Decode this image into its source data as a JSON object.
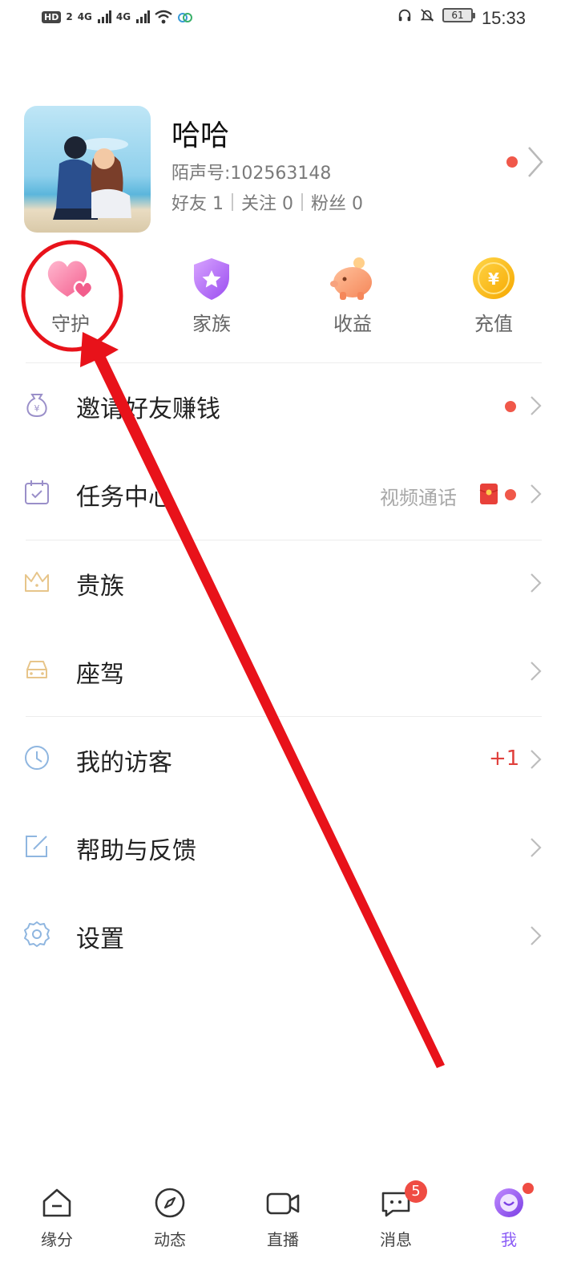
{
  "status_bar": {
    "hd": "HD",
    "hd_sim": "2",
    "signal_1": "4G",
    "signal_2": "4G",
    "battery": "61",
    "time": "15:33"
  },
  "profile": {
    "name": "哈哈",
    "id_text": "陌声号:102563148",
    "friends": "好友 1",
    "following": "关注 0",
    "fans": "粉丝 0"
  },
  "quick_actions": [
    {
      "label": "守护",
      "icon": "heart-icon"
    },
    {
      "label": "家族",
      "icon": "shield-star-icon"
    },
    {
      "label": "收益",
      "icon": "piggy-bank-icon"
    },
    {
      "label": "充值",
      "icon": "yuan-coin-icon"
    }
  ],
  "menu": [
    {
      "label": "邀请好友赚钱",
      "icon": "money-bag-icon",
      "dot": true
    },
    {
      "label": "任务中心",
      "icon": "calendar-check-icon",
      "aux": "视频通话",
      "red_packet": true,
      "dot": true
    },
    {
      "label": "贵族",
      "icon": "crown-icon"
    },
    {
      "label": "座驾",
      "icon": "car-icon"
    },
    {
      "label": "我的访客",
      "icon": "clock-icon",
      "badge": "+1"
    },
    {
      "label": "帮助与反馈",
      "icon": "edit-icon"
    },
    {
      "label": "设置",
      "icon": "gear-icon"
    }
  ],
  "bottom_nav": [
    {
      "label": "缘分",
      "icon": "home-icon"
    },
    {
      "label": "动态",
      "icon": "compass-icon"
    },
    {
      "label": "直播",
      "icon": "video-camera-icon"
    },
    {
      "label": "消息",
      "icon": "chat-icon",
      "count": "5"
    },
    {
      "label": "我",
      "icon": "smile-face-icon",
      "active": true,
      "dot": true
    }
  ],
  "colors": {
    "accent": "#8b5cf6",
    "red_dot": "#f0584a",
    "annotation": "#e8121a"
  }
}
